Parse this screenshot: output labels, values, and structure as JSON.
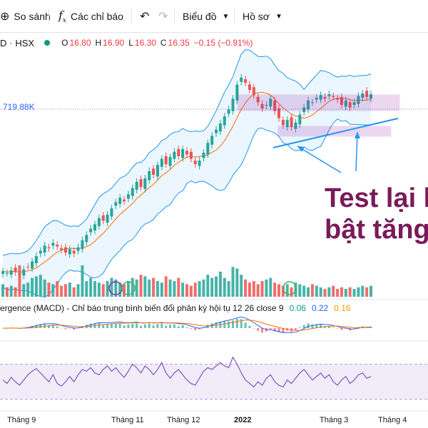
{
  "toolbar": {
    "compare_label": "So sánh",
    "indicators_label": "Các chỉ báo",
    "chart_type_label": "Biểu đồ",
    "profile_label": "Hồ sơ",
    "icons": [
      "compare-plus-icon",
      "fx-icon",
      "undo-icon",
      "redo-icon",
      "chevron-down-icon"
    ]
  },
  "legend": {
    "prefix": "D",
    "exchange": "HSX",
    "open_label": "O",
    "open": "16.80",
    "high_label": "H",
    "high": "16.90",
    "low_label": "L",
    "low": "16.30",
    "close_label": "C",
    "close": "16.35",
    "change": "−0.15 (−0.91%)",
    "status_color": "#089981"
  },
  "volume_label": "719.88K",
  "macd": {
    "label": "ergence (MACD) - Chỉ báo trung bình biến đổi phân kỳ hội tụ 12 26 close 9",
    "v1": "0.06",
    "v2": "0.22",
    "v3": "0.16"
  },
  "annotation": {
    "line1": "Test lại h",
    "line2": "bật tăng"
  },
  "time_axis": [
    "Tháng 9",
    "Tháng 11",
    "Tháng 12",
    "2022",
    "Tháng 3",
    "Tháng 4"
  ],
  "chart_data": {
    "type": "candlestick",
    "closes": [
      14.1,
      13.9,
      14.2,
      14.0,
      13.8,
      14.3,
      14.6,
      15.2,
      15.8,
      16.4,
      17.0,
      16.7,
      17.3,
      16.9,
      16.5,
      16.2,
      16.6,
      16.1,
      16.8,
      17.6,
      18.2,
      18.9,
      19.4,
      20.1,
      19.8,
      20.5,
      21.2,
      21.9,
      22.4,
      22.0,
      22.8,
      23.5,
      24.2,
      23.6,
      24.6,
      25.4,
      25.0,
      26.1,
      26.8,
      26.2,
      27.0,
      27.6,
      27.1,
      27.9,
      27.3,
      26.8,
      26.2,
      26.6,
      27.5,
      28.6,
      29.4,
      30.1,
      30.8,
      31.6,
      32.4,
      33.6,
      35.2,
      36.0,
      35.4,
      34.6,
      34.0,
      33.2,
      32.5,
      32.9,
      33.6,
      32.2,
      31.4,
      30.6,
      31.2,
      30.4,
      30.9,
      31.8,
      32.6,
      33.4,
      33.2,
      33.7,
      34.0,
      33.6,
      34.1,
      33.8,
      33.5,
      32.9,
      33.4,
      32.6,
      33.2,
      33.9,
      34.2,
      33.8,
      34.1
    ],
    "price_range": [
      12.5,
      37.5
    ],
    "bollinger_upper_color": "#2196f3",
    "bollinger_basis_color": "#ff6d00",
    "bollinger_fill": "#e3f2fd",
    "volume": [
      0.4,
      0.3,
      0.35,
      0.3,
      0.55,
      0.4,
      0.45,
      0.6,
      0.65,
      0.7,
      0.55,
      0.45,
      0.4,
      0.5,
      0.35,
      0.4,
      0.45,
      0.3,
      0.4,
      0.55,
      0.5,
      0.6,
      0.5,
      0.45,
      0.4,
      0.5,
      0.6,
      0.55,
      0.45,
      0.4,
      0.5,
      0.6,
      0.55,
      0.7,
      0.65,
      0.55,
      0.6,
      0.5,
      0.45,
      0.65,
      0.55,
      0.5,
      0.6,
      0.45,
      0.4,
      0.35,
      0.45,
      0.5,
      0.55,
      0.7,
      0.6,
      0.65,
      0.8,
      0.6,
      0.5,
      0.75,
      0.9,
      0.7,
      0.55,
      0.45,
      0.5,
      0.4,
      0.5,
      0.55,
      0.6,
      0.45,
      0.4,
      0.35,
      0.4,
      0.3,
      0.45,
      0.4,
      0.35,
      0.3,
      0.4,
      0.35,
      0.3,
      0.25,
      0.3,
      0.35,
      0.25,
      0.3,
      0.25,
      0.3,
      0.25,
      0.3,
      0.35,
      0.3,
      0.35
    ],
    "volume_spikes": {
      "4": 1.0,
      "19": 1.0,
      "55": 0.95
    },
    "up_color": "#26a69a",
    "down_color": "#ef5350",
    "rsi": [
      52,
      48,
      55,
      50,
      46,
      52,
      58,
      62,
      65,
      60,
      55,
      50,
      58,
      48,
      45,
      50,
      56,
      50,
      58,
      64,
      62,
      66,
      60,
      58,
      64,
      68,
      62,
      66,
      60,
      55,
      62,
      70,
      66,
      60,
      68,
      64,
      58,
      64,
      72,
      60,
      54,
      60,
      64,
      58,
      52,
      48,
      46,
      54,
      62,
      66,
      64,
      68,
      72,
      68,
      66,
      78,
      70,
      60,
      52,
      48,
      44,
      50,
      46,
      54,
      58,
      50,
      46,
      44,
      52,
      48,
      54,
      60,
      64,
      58,
      52,
      56,
      60,
      54,
      58,
      50,
      46,
      52,
      56,
      48,
      52,
      58,
      60,
      54,
      56
    ],
    "rsi_range": [
      0,
      100
    ],
    "rsi_band": [
      30,
      70
    ],
    "rsi_color": "#7e57c2",
    "macd_color": "#2962ff",
    "signal_color": "#ff6d00",
    "support_zone_color": "#9c27b0",
    "annotation_line_color": "#2196f3"
  }
}
